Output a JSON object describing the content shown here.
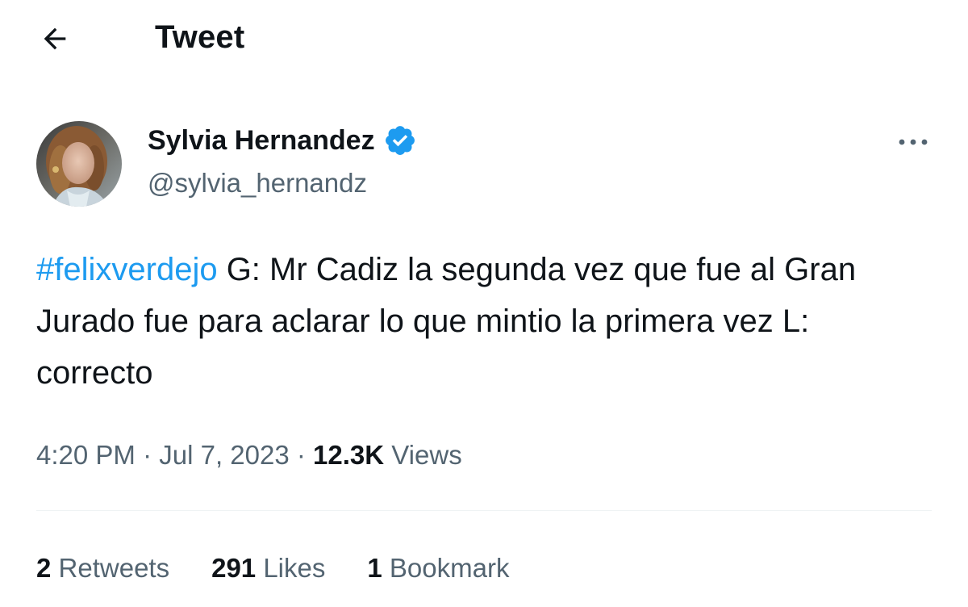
{
  "header": {
    "back_icon": "arrow-left-icon",
    "title": "Tweet"
  },
  "author": {
    "display_name": "Sylvia Hernandez",
    "handle": "@sylvia_hernandz",
    "verified_icon": "verified-badge-icon",
    "verified_color": "#1d9bf0"
  },
  "more_icon": "more-horizontal-icon",
  "tweet": {
    "hashtag": "#felixverdejo",
    "text": " G: Mr Cadiz la segunda vez que fue al Gran Jurado fue para aclarar lo que mintio la primera vez L: correcto"
  },
  "meta": {
    "time": "4:20 PM",
    "separator": " · ",
    "date": "Jul 7, 2023",
    "views_count": "12.3K",
    "views_label": " Views"
  },
  "stats": {
    "retweets_count": "2",
    "retweets_label": " Retweets",
    "likes_count": "291",
    "likes_label": " Likes",
    "bookmarks_count": "1",
    "bookmarks_label": " Bookmark"
  },
  "colors": {
    "accent": "#1d9bf0",
    "text_primary": "#0f1419",
    "text_secondary": "#536471",
    "divider": "#eff3f4"
  }
}
